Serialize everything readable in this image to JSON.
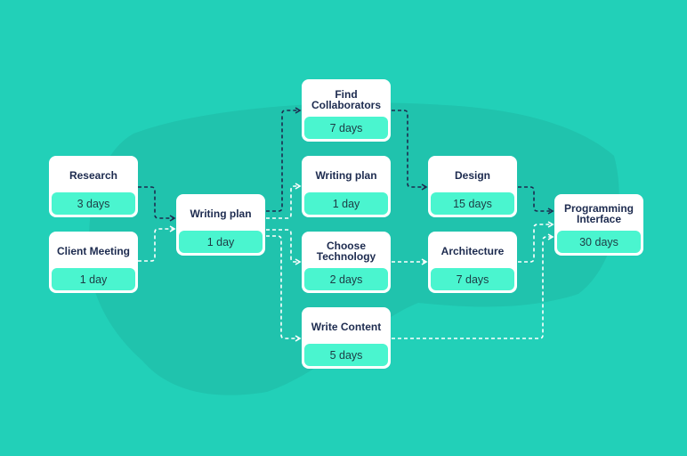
{
  "diagram": {
    "type": "project-network-diagram",
    "colors": {
      "background": "#22d0b8",
      "card": "#ffffff",
      "duration_pill": "#4af5cf",
      "title_text": "#1d2b4f",
      "critical_path": "#1d2b4f",
      "secondary_path": "#ffffff"
    },
    "nodes": [
      {
        "id": "research",
        "title": "Research",
        "duration": "3 days"
      },
      {
        "id": "client-meeting",
        "title": "Client Meeting",
        "duration": "1 day"
      },
      {
        "id": "writing-plan-1",
        "title": "Writing plan",
        "duration": "1 day"
      },
      {
        "id": "find-collaborators",
        "title": "Find Collaborators",
        "duration": "7 days"
      },
      {
        "id": "writing-plan-2",
        "title": "Writing plan",
        "duration": "1 day"
      },
      {
        "id": "choose-technology",
        "title": "Choose Technology",
        "duration": "2 days"
      },
      {
        "id": "write-content",
        "title": "Write Content",
        "duration": "5 days"
      },
      {
        "id": "design",
        "title": "Design",
        "duration": "15 days"
      },
      {
        "id": "architecture",
        "title": "Architecture",
        "duration": "7 days"
      },
      {
        "id": "programming-interface",
        "title": "Programming Interface",
        "duration": "30 days"
      }
    ],
    "edges": [
      {
        "from": "research",
        "to": "writing-plan-1",
        "style": "critical"
      },
      {
        "from": "client-meeting",
        "to": "writing-plan-1",
        "style": "secondary"
      },
      {
        "from": "writing-plan-1",
        "to": "find-collaborators",
        "style": "critical"
      },
      {
        "from": "writing-plan-1",
        "to": "writing-plan-2",
        "style": "secondary"
      },
      {
        "from": "writing-plan-1",
        "to": "choose-technology",
        "style": "secondary"
      },
      {
        "from": "writing-plan-1",
        "to": "write-content",
        "style": "secondary"
      },
      {
        "from": "find-collaborators",
        "to": "design",
        "style": "critical"
      },
      {
        "from": "choose-technology",
        "to": "architecture",
        "style": "secondary"
      },
      {
        "from": "design",
        "to": "programming-interface",
        "style": "critical"
      },
      {
        "from": "architecture",
        "to": "programming-interface",
        "style": "secondary"
      },
      {
        "from": "write-content",
        "to": "programming-interface",
        "style": "secondary"
      }
    ]
  }
}
